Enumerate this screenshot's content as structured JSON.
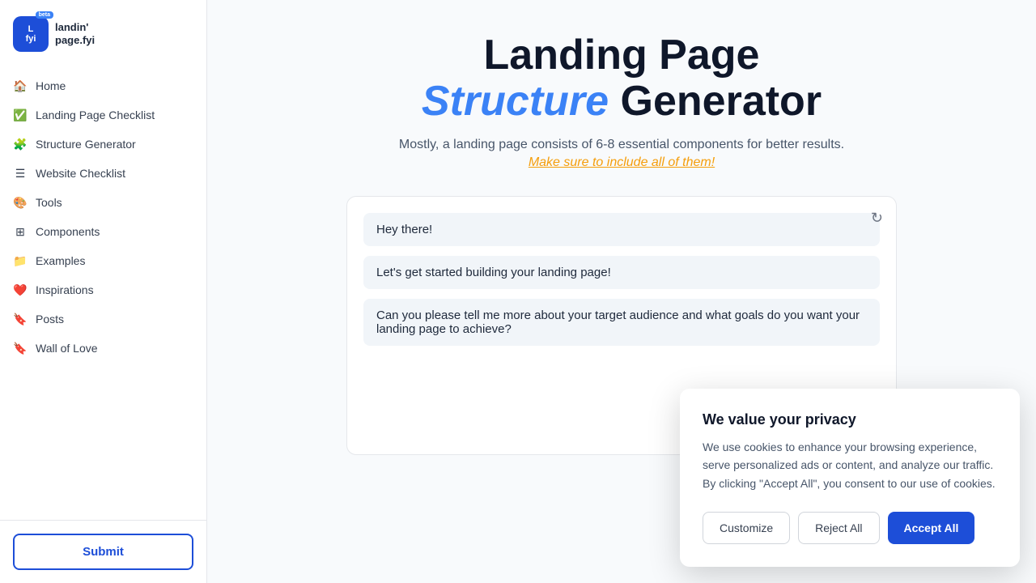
{
  "sidebar": {
    "logo": {
      "line1": "landin'",
      "line2": "page.fyi",
      "badge": "beta"
    },
    "nav_items": [
      {
        "id": "home",
        "label": "Home",
        "icon": "🏠"
      },
      {
        "id": "landing-page-checklist",
        "label": "Landing Page Checklist",
        "icon": "✅"
      },
      {
        "id": "structure-generator",
        "label": "Structure Generator",
        "icon": "🧩"
      },
      {
        "id": "website-checklist",
        "label": "Website Checklist",
        "icon": "☰"
      },
      {
        "id": "tools",
        "label": "Tools",
        "icon": "🎨"
      },
      {
        "id": "components",
        "label": "Components",
        "icon": "⊞"
      },
      {
        "id": "examples",
        "label": "Examples",
        "icon": "📁"
      },
      {
        "id": "inspirations",
        "label": "Inspirations",
        "icon": "❤️"
      },
      {
        "id": "posts",
        "label": "Posts",
        "icon": "🔖"
      },
      {
        "id": "wall-of-love",
        "label": "Wall of Love",
        "icon": "🔖"
      }
    ],
    "submit_label": "Submit"
  },
  "main": {
    "heading_line1": "Landing Page",
    "heading_line2_accent": "Structure",
    "heading_line2_rest": " Generator",
    "subtext": "Mostly, a landing page consists of 6-8 essential components for better results.",
    "subtext_italic": "Make sure to include all of them!",
    "chat_bubbles": [
      {
        "text": "Hey there!"
      },
      {
        "text": "Let's get started building your landing page!"
      },
      {
        "text": "Can you please tell me more about your target audience and what goals do you want your landing page to achieve?"
      }
    ],
    "refresh_icon": "↻"
  },
  "cookie": {
    "title": "We value your privacy",
    "text": "We use cookies to enhance your browsing experience, serve personalized ads or content, and analyze our traffic. By clicking \"Accept All\", you consent to our use of cookies.",
    "customize_label": "Customize",
    "reject_label": "Reject All",
    "accept_label": "Accept All"
  }
}
